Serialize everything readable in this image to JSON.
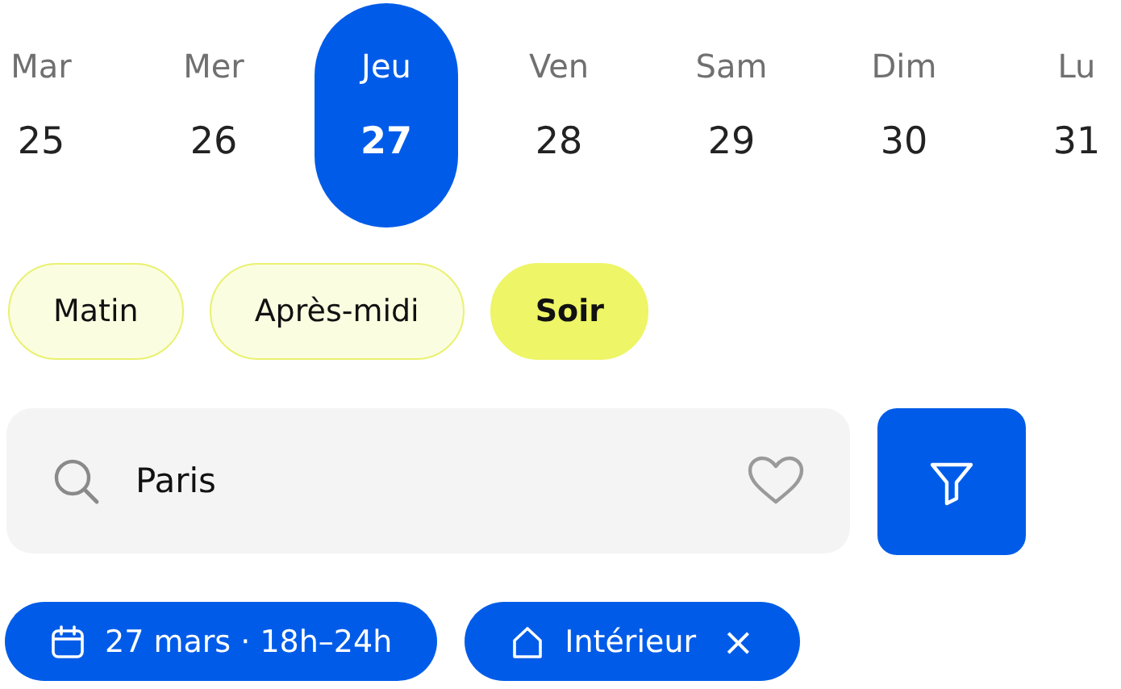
{
  "days": [
    {
      "weekday": "Mar",
      "date": "25",
      "selected": false
    },
    {
      "weekday": "Mer",
      "date": "26",
      "selected": false
    },
    {
      "weekday": "Jeu",
      "date": "27",
      "selected": true
    },
    {
      "weekday": "Ven",
      "date": "28",
      "selected": false
    },
    {
      "weekday": "Sam",
      "date": "29",
      "selected": false
    },
    {
      "weekday": "Dim",
      "date": "30",
      "selected": false
    },
    {
      "weekday": "Lu",
      "date": "31",
      "selected": false
    }
  ],
  "periods": [
    {
      "label": "Matin",
      "selected": false
    },
    {
      "label": "Après-midi",
      "selected": false
    },
    {
      "label": "Soir",
      "selected": true
    }
  ],
  "search": {
    "value": "Paris",
    "favorite": false
  },
  "filters": [
    {
      "kind": "date",
      "label": "27 mars · 18h–24h",
      "removable": false
    },
    {
      "kind": "place",
      "label": "Intérieur",
      "removable": true,
      "remove": "×"
    }
  ]
}
